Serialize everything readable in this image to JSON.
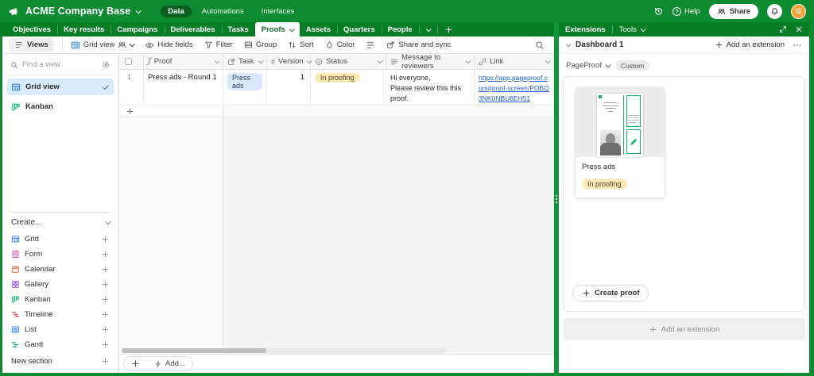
{
  "colors": {
    "brand_green": "#0e8a30",
    "tab_row_green": "#077d26",
    "active_tab_text": "#166b2d",
    "selected_view_bg": "#d9ecff",
    "task_chip_bg": "#dbe7fd",
    "status_chip_bg": "#ffe9b3",
    "link_blue": "#2160d3",
    "avatar_orange": "#f6a33c",
    "pageproof_green": "#17b26a"
  },
  "glyphs": {
    "formula": "ƒ",
    "hash": "#",
    "question": "?"
  },
  "topbar": {
    "base_name": "ACME Company Base",
    "nav": [
      "Data",
      "Automations",
      "Interfaces"
    ],
    "help_label": "Help",
    "share_label": "Share",
    "avatar_initial": "G"
  },
  "tabbar": {
    "tabs": [
      "Objectives",
      "Key results",
      "Campaigns",
      "Deliverables",
      "Tasks",
      "Proofs",
      "Assets",
      "Quarters",
      "People"
    ],
    "active_tab": "Proofs"
  },
  "toolbar": {
    "views": "Views",
    "grid_view": "Grid view",
    "hide_fields": "Hide fields",
    "filter": "Filter",
    "group": "Group",
    "sort": "Sort",
    "color": "Color",
    "share_and_sync": "Share and sync"
  },
  "sidebar": {
    "find_placeholder": "Find a view",
    "views": [
      {
        "label": "Grid view"
      },
      {
        "label": "Kanban"
      }
    ],
    "create_label": "Create...",
    "create_items": [
      {
        "label": "Grid"
      },
      {
        "label": "Form"
      },
      {
        "label": "Calendar"
      },
      {
        "label": "Gallery"
      },
      {
        "label": "Kanban"
      },
      {
        "label": "Timeline"
      },
      {
        "label": "List"
      },
      {
        "label": "Gantt"
      }
    ],
    "new_section_label": "New section"
  },
  "grid": {
    "columns": [
      "Proof",
      "Task",
      "Version",
      "Status",
      "Message to reviewers",
      "Link"
    ],
    "row": {
      "num": "1",
      "proof": "Press ads - Round 1",
      "task_chip": "Press ads",
      "version": "1",
      "status_chip": "In proofing",
      "message_line1": "Hi everyone,",
      "message_line2": "Please review this this proof.",
      "link": "https://app.pageproof.com/proof-screen/POBQ3NK0NBU6EH51"
    },
    "add_record_label": "Add..."
  },
  "panel": {
    "header_title": "Extensions",
    "tools_label": "Tools",
    "dashboard_title": "Dashboard 1",
    "add_extension_label": "Add an extension",
    "bottom_add_extension_label": "Add an extension",
    "pageproof": {
      "tab_label": "PageProof",
      "custom_label": "Custom",
      "card_title": "Press ads",
      "card_status": "In proofing",
      "create_proof_label": "Create proof"
    }
  }
}
